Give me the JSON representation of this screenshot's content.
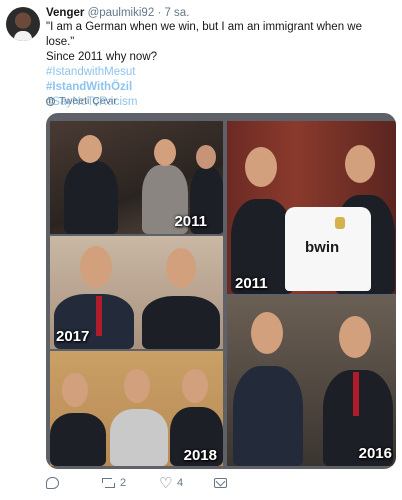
{
  "tweet": {
    "author_name": "Venger",
    "handle": "@paulmiki92",
    "separator": "·",
    "time": "7 sa.",
    "text_lines": [
      "\"I am a German when we win, but I am an immigrant when we lose.\"",
      "Since 2011 why now?"
    ],
    "hashtags": [
      "#IstandwithMesut",
      "#IstandWithÖzil",
      "#SayNoToRacism"
    ],
    "translate_label": "Tweeti Çevir"
  },
  "media": {
    "photos": [
      {
        "year_label": "2011"
      },
      {
        "year_label": "2011",
        "jersey_text": "bwin"
      },
      {
        "year_label": "2017"
      },
      {
        "year_label": "2016"
      },
      {
        "year_label": "2018"
      }
    ]
  },
  "actions": {
    "reply_count": "",
    "retweet_count": "2",
    "like_count": "4"
  },
  "colors": {
    "hashtag": "#8ec3ee",
    "meta": "#657786",
    "text": "#14171a"
  }
}
